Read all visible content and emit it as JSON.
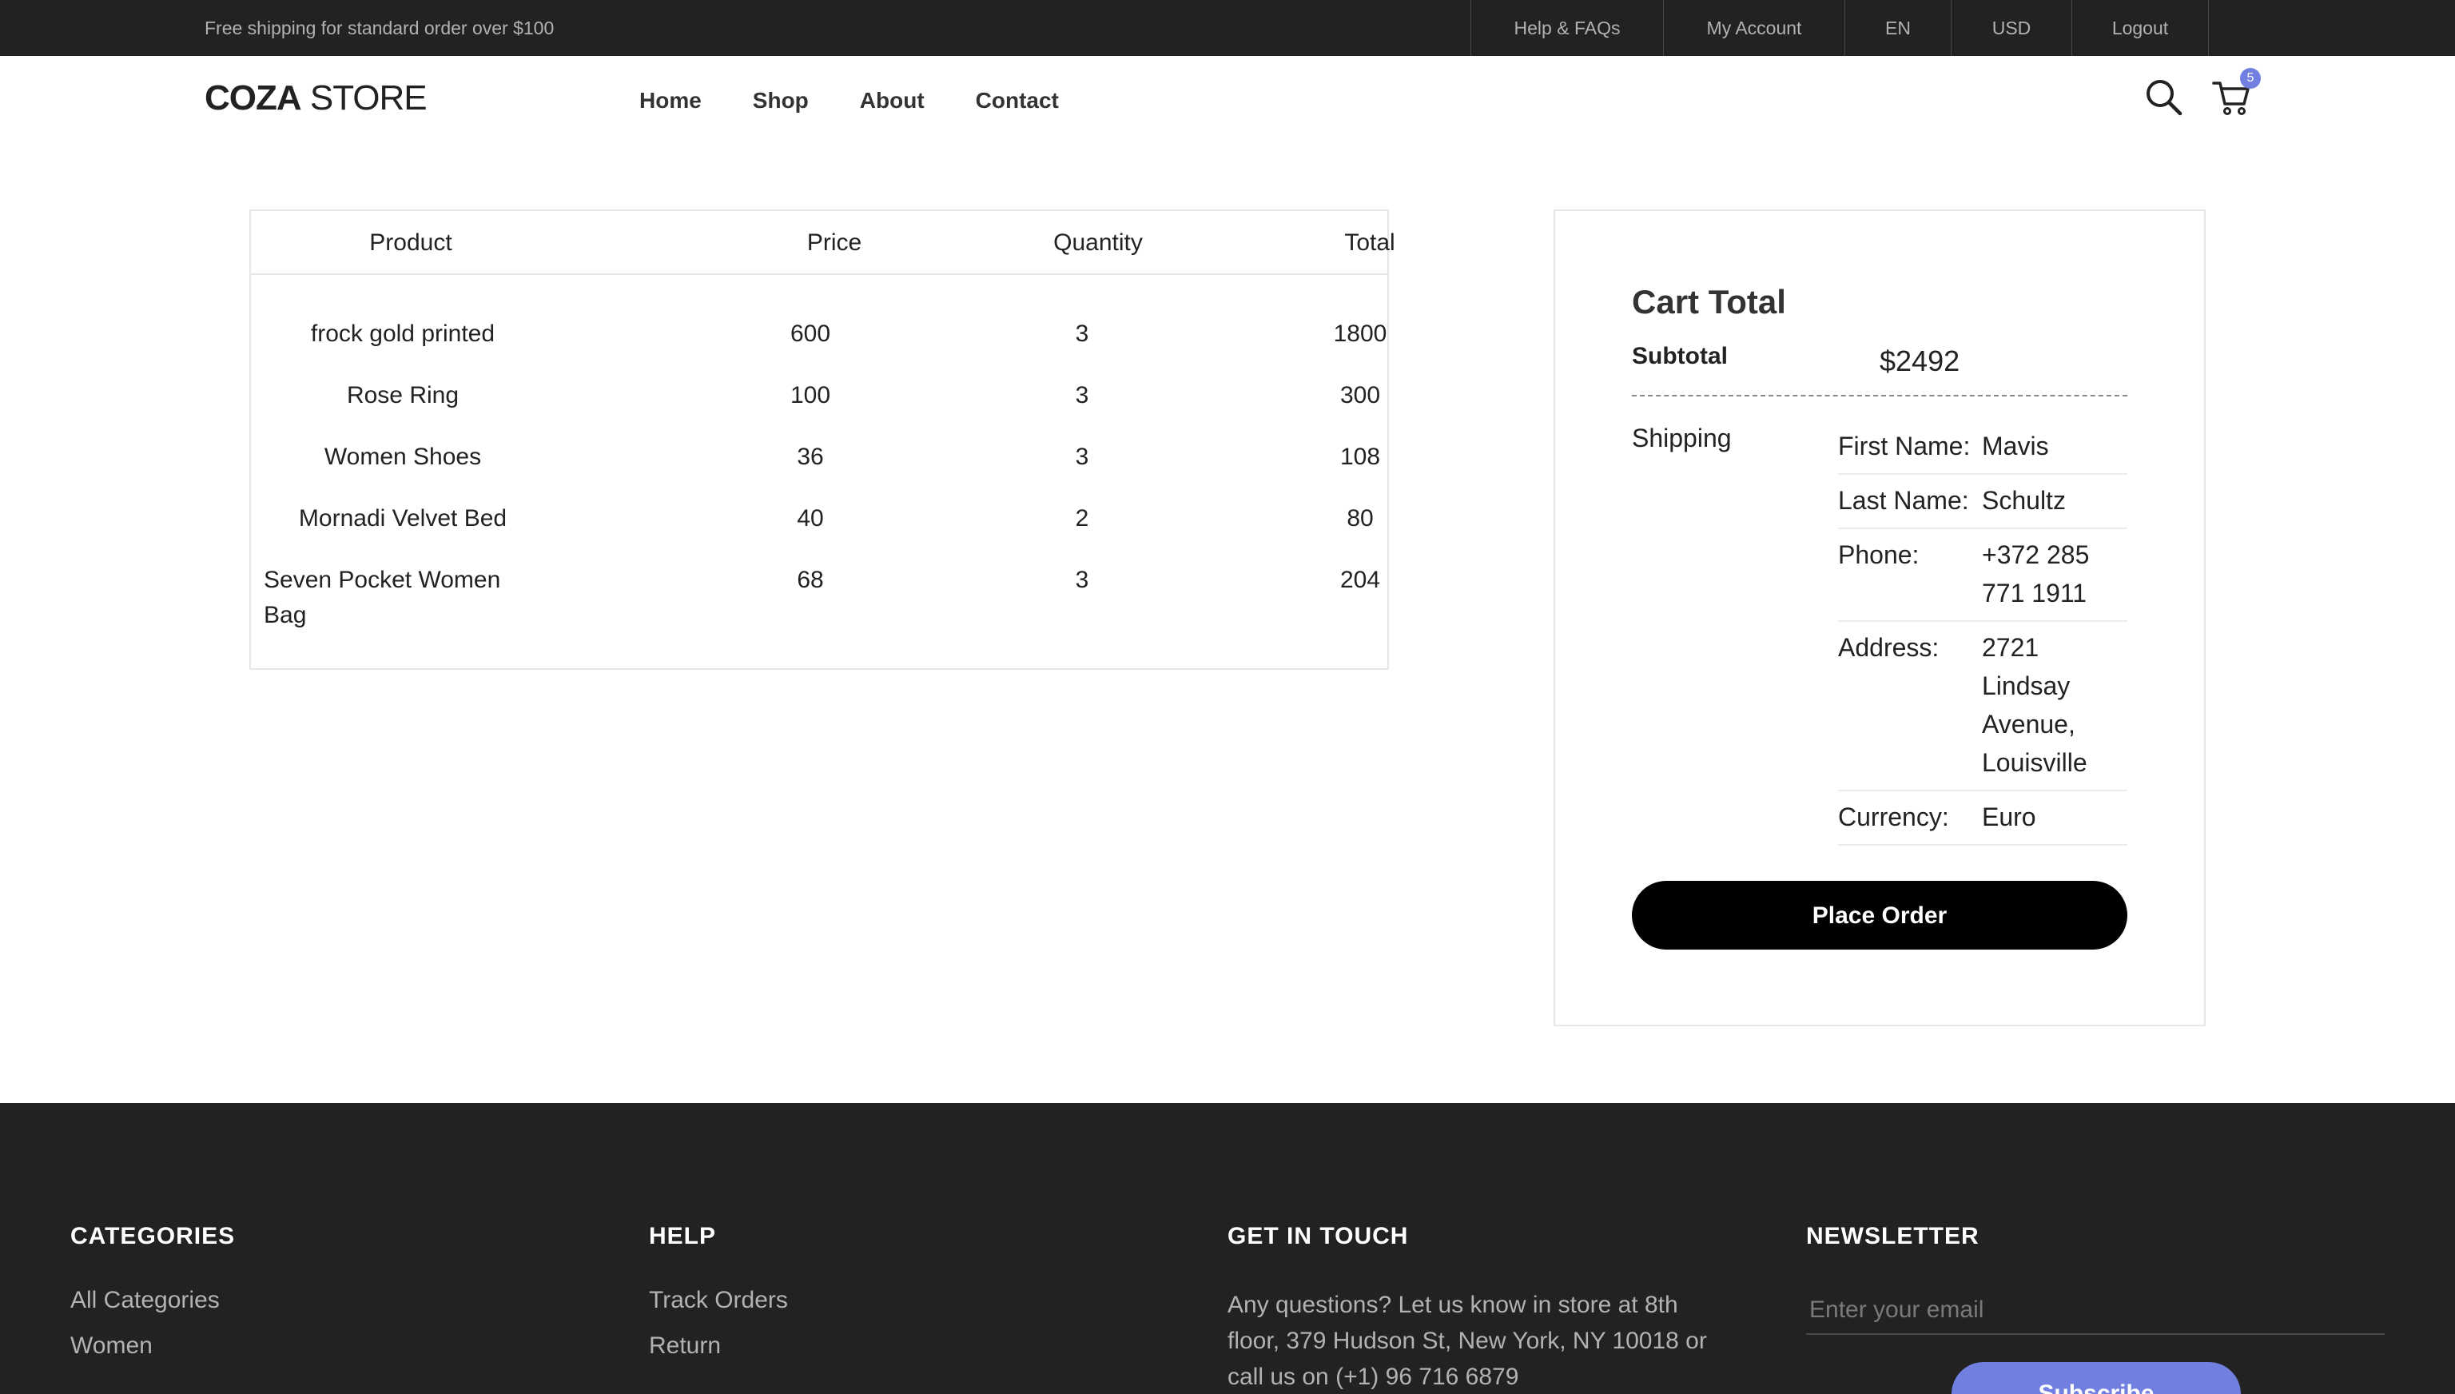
{
  "topbar": {
    "promo": "Free shipping for standard order over $100",
    "links": [
      "Help & FAQs",
      "My Account",
      "EN",
      "USD",
      "Logout"
    ]
  },
  "header": {
    "logo_bold": "COZA",
    "logo_thin": " STORE",
    "nav": [
      "Home",
      "Shop",
      "About",
      "Contact"
    ],
    "cart_count": "5",
    "icons": [
      "search-icon",
      "cart-icon"
    ]
  },
  "cart": {
    "headers": [
      "Product",
      "Price",
      "Quantity",
      "Total"
    ],
    "rows": [
      {
        "product": "frock gold printed",
        "price": "600",
        "qty": "3",
        "total": "1800"
      },
      {
        "product": "Rose Ring",
        "price": "100",
        "qty": "3",
        "total": "300"
      },
      {
        "product": "Women Shoes",
        "price": "36",
        "qty": "3",
        "total": "108"
      },
      {
        "product": "Mornadi Velvet Bed",
        "price": "40",
        "qty": "2",
        "total": "80"
      },
      {
        "product": "Seven Pocket Women Bag",
        "price": "68",
        "qty": "3",
        "total": "204"
      }
    ]
  },
  "summary": {
    "title": "Cart Total",
    "subtotal_label": "Subtotal",
    "subtotal_value": "$2492",
    "shipping_label": "Shipping",
    "shipping": [
      {
        "key": "First Name:",
        "value": "Mavis"
      },
      {
        "key": "Last Name:",
        "value": "Schultz"
      },
      {
        "key": "Phone:",
        "value": "+372 285 771 1911"
      },
      {
        "key": "Address:",
        "value": "2721 Lindsay Avenue, Louisville"
      },
      {
        "key": "Currency:",
        "value": "Euro"
      }
    ],
    "place_order": "Place Order"
  },
  "footer": {
    "categories": {
      "title": "CATEGORIES",
      "items": [
        "All Categories",
        "Women"
      ]
    },
    "help": {
      "title": "HELP",
      "items": [
        "Track Orders",
        "Return"
      ]
    },
    "contact": {
      "title": "GET IN TOUCH",
      "text": "Any questions? Let us know in store at 8th floor, 379 Hudson St, New York, NY 10018 or call us on (+1) 96 716 6879"
    },
    "newsletter": {
      "title": "NEWSLETTER",
      "placeholder": "Enter your email",
      "button": "Subscribe"
    }
  },
  "colors": {
    "dark": "#222222",
    "accent": "#717fe0",
    "button": "#000000"
  }
}
